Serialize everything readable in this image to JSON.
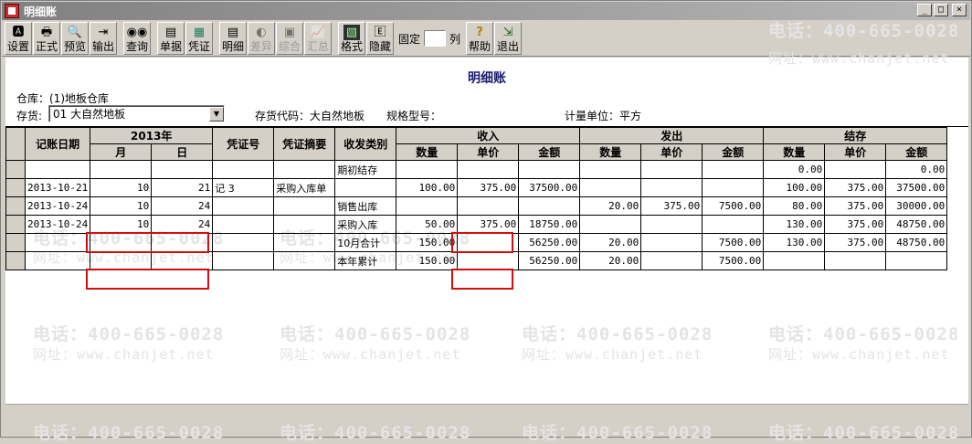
{
  "window": {
    "title": "明细账"
  },
  "toolbar": {
    "items": [
      {
        "label": "设置",
        "icon": "setup-icon",
        "enabled": true
      },
      {
        "label": "正式",
        "icon": "print-icon",
        "enabled": true
      },
      {
        "label": "预览",
        "icon": "preview-icon",
        "enabled": true
      },
      {
        "label": "输出",
        "icon": "export-icon",
        "enabled": true
      },
      {
        "label": "查询",
        "icon": "binoculars-icon",
        "enabled": true
      },
      {
        "label": "单据",
        "icon": "document-icon",
        "enabled": true
      },
      {
        "label": "凭证",
        "icon": "voucher-icon",
        "enabled": true
      },
      {
        "label": "明细",
        "icon": "detail-icon",
        "enabled": true
      },
      {
        "label": "差异",
        "icon": "difference-icon",
        "enabled": false
      },
      {
        "label": "综合",
        "icon": "summary-icon",
        "enabled": false
      },
      {
        "label": "汇总",
        "icon": "chart-icon",
        "enabled": false
      },
      {
        "label": "格式",
        "icon": "format-icon",
        "enabled": true
      },
      {
        "label": "隐藏",
        "icon": "hide-icon",
        "enabled": true
      },
      {
        "label": "帮助",
        "icon": "help-icon",
        "enabled": true
      },
      {
        "label": "退出",
        "icon": "exit-icon",
        "enabled": true
      }
    ],
    "fix_label": "固定",
    "fix_value": "",
    "col_label": "列"
  },
  "report": {
    "title": "明细账",
    "warehouse_label": "仓库：(1)地板仓库",
    "inventory_label": "存货:",
    "inventory_value": "01 大自然地板",
    "code_label": "存货代码：大自然地板",
    "spec_label": "规格型号：",
    "unit_label": "计量单位：平方"
  },
  "watermark": {
    "phone": "电话：400-665-0028",
    "site": "网址：www.chanjet.net"
  },
  "table": {
    "headers": {
      "date": "记账日期",
      "year": "2013年",
      "month": "月",
      "day": "日",
      "voucher_no": "凭证号",
      "voucher_summary": "凭证摘要",
      "type": "收发类别",
      "income": "收入",
      "outgo": "发出",
      "balance": "结存",
      "qty": "数量",
      "price": "单价",
      "amount": "金额"
    },
    "rows": [
      {
        "date": "",
        "month": "",
        "day": "",
        "vno": "",
        "vsum": "",
        "type": "期初结存",
        "iq": "",
        "ip": "",
        "ia": "",
        "oq": "",
        "op": "",
        "oa": "",
        "bq": "0.00",
        "bp": "",
        "ba": "0.00"
      },
      {
        "date": "2013-10-21",
        "month": "10",
        "day": "21",
        "vno": "记 3",
        "vsum": "采购入库单",
        "type": "",
        "iq": "100.00",
        "ip": "375.00",
        "ia": "37500.00",
        "oq": "",
        "op": "",
        "oa": "",
        "bq": "100.00",
        "bp": "375.00",
        "ba": "37500.00"
      },
      {
        "date": "2013-10-24",
        "month": "10",
        "day": "24",
        "vno": "",
        "vsum": "",
        "type": "销售出库",
        "iq": "",
        "ip": "",
        "ia": "",
        "oq": "20.00",
        "op": "375.00",
        "oa": "7500.00",
        "bq": "80.00",
        "bp": "375.00",
        "ba": "30000.00"
      },
      {
        "date": "2013-10-24",
        "month": "10",
        "day": "24",
        "vno": "",
        "vsum": "",
        "type": "采购入库",
        "iq": "50.00",
        "ip": "375.00",
        "ia": "18750.00",
        "oq": "",
        "op": "",
        "oa": "",
        "bq": "130.00",
        "bp": "375.00",
        "ba": "48750.00"
      },
      {
        "date": "",
        "month": "",
        "day": "",
        "vno": "",
        "vsum": "",
        "type": "10月合计",
        "iq": "150.00",
        "ip": "",
        "ia": "56250.00",
        "oq": "20.00",
        "op": "",
        "oa": "7500.00",
        "bq": "130.00",
        "bp": "375.00",
        "ba": "48750.00"
      },
      {
        "date": "",
        "month": "",
        "day": "",
        "vno": "",
        "vsum": "",
        "type": "本年累计",
        "iq": "150.00",
        "ip": "",
        "ia": "56250.00",
        "oq": "20.00",
        "op": "",
        "oa": "7500.00",
        "bq": "",
        "bp": "",
        "ba": ""
      }
    ]
  }
}
